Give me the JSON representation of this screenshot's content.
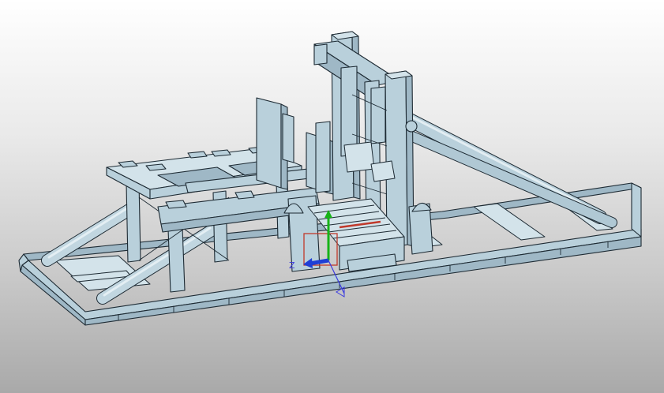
{
  "viewer": {
    "background_top": "#ffffff",
    "background_bottom": "#a9a9a9",
    "model_color": "#b9d0db",
    "edge_color": "#1d2a33"
  },
  "triad": {
    "x_color": "#1f3fd6",
    "y_color": "#17b317",
    "z_color": "#3a3adf",
    "z_label": "Z"
  },
  "selection": {
    "color": "#c0392b"
  }
}
